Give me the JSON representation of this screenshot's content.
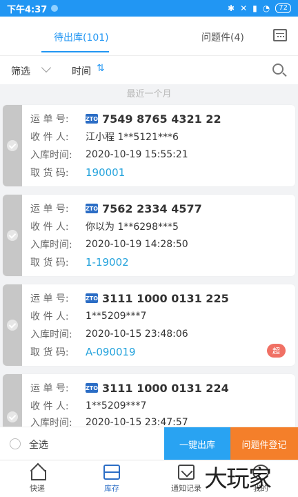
{
  "status_bar": {
    "time": "下午4:37",
    "battery": "72"
  },
  "tabs": {
    "pending": "待出库(101)",
    "problem": "问题件(4)"
  },
  "filter": {
    "filter_label": "筛选",
    "time_label": "时间",
    "sort_glyph": "⇅"
  },
  "section_header": "最近一个月",
  "field_labels": {
    "waybill": "运 单 号:",
    "receiver": "收 件 人:",
    "in_time": "入库时间:",
    "pickup_code": "取 货 码:"
  },
  "courier_icon": "zto-icon",
  "cards": [
    {
      "waybill": "7549 8765 4321 22",
      "receiver": "江小程 1**5121***6",
      "in_time": "2020-10-19 15:55:21",
      "pickup_code": "190001"
    },
    {
      "waybill": "7562 2334 4577",
      "receiver": "你以为 1**6298***5",
      "in_time": "2020-10-19 14:28:50",
      "pickup_code": "1-19002"
    },
    {
      "waybill": "3111 1000 0131 225",
      "receiver": "1**5209***7",
      "in_time": "2020-10-15 23:48:06",
      "pickup_code": "A-090019",
      "badge": "超"
    },
    {
      "waybill": "3111 1000 0131 224",
      "receiver": "1**5209***7",
      "in_time": "2020-10-15 23:47:57",
      "pickup_code": ""
    }
  ],
  "bottom_actions": {
    "select_all": "全选",
    "dispatch": "一键出库",
    "problem_register": "问题件登记"
  },
  "nav": {
    "home": "快递",
    "inventory": "库存",
    "notify": "通知记录",
    "mine": "我的"
  },
  "watermark": "大玩家",
  "colors": {
    "accent": "#2196f3",
    "code": "#25a3dc",
    "dispatch": "#29a3f2",
    "problem": "#f47f2a",
    "badge": "#f07064"
  }
}
